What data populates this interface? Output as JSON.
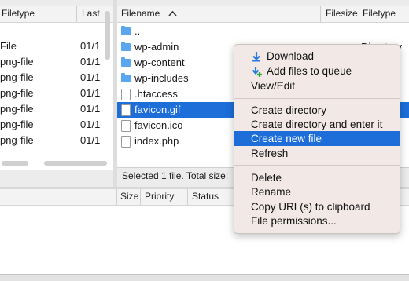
{
  "local": {
    "columns": {
      "filetype": "Filetype",
      "last": "Last"
    },
    "rows": [
      {
        "type": "File",
        "date": "01/1"
      },
      {
        "type": "png-file",
        "date": "01/1"
      },
      {
        "type": "png-file",
        "date": "01/1"
      },
      {
        "type": "png-file",
        "date": "01/1"
      },
      {
        "type": "png-file",
        "date": "01/1"
      },
      {
        "type": "png-file",
        "date": "01/1"
      },
      {
        "type": "png-file",
        "date": "01/1"
      }
    ]
  },
  "remote": {
    "columns": {
      "filename": "Filename",
      "filesize": "Filesize",
      "filetype": "Filetype"
    },
    "rows": [
      {
        "name": "..",
        "icon": "folder-icon"
      },
      {
        "name": "wp-admin",
        "icon": "folder-icon",
        "type": "Directory"
      },
      {
        "name": "wp-content",
        "icon": "folder-icon"
      },
      {
        "name": "wp-includes",
        "icon": "folder-icon"
      },
      {
        "name": ".htaccess",
        "icon": "file-icon"
      },
      {
        "name": "favicon.gif",
        "icon": "file-icon",
        "selected": true
      },
      {
        "name": "favicon.ico",
        "icon": "file-icon"
      },
      {
        "name": "index.php",
        "icon": "file-icon"
      }
    ],
    "status": "Selected 1 file. Total size:"
  },
  "queue": {
    "columns": {
      "size": "Size",
      "priority": "Priority",
      "status": "Status"
    }
  },
  "context_menu": {
    "download": "Download",
    "add_to_queue": "Add files to queue",
    "view_edit": "View/Edit",
    "create_dir": "Create directory",
    "create_dir_enter": "Create directory and enter it",
    "create_file": "Create new file",
    "refresh": "Refresh",
    "delete": "Delete",
    "rename": "Rename",
    "copy_url": "Copy URL(s) to clipboard",
    "permissions": "File permissions..."
  },
  "colors": {
    "selection": "#1d6ed9",
    "folder": "#5aa7ef",
    "menu_bg": "#f2e9e6"
  }
}
